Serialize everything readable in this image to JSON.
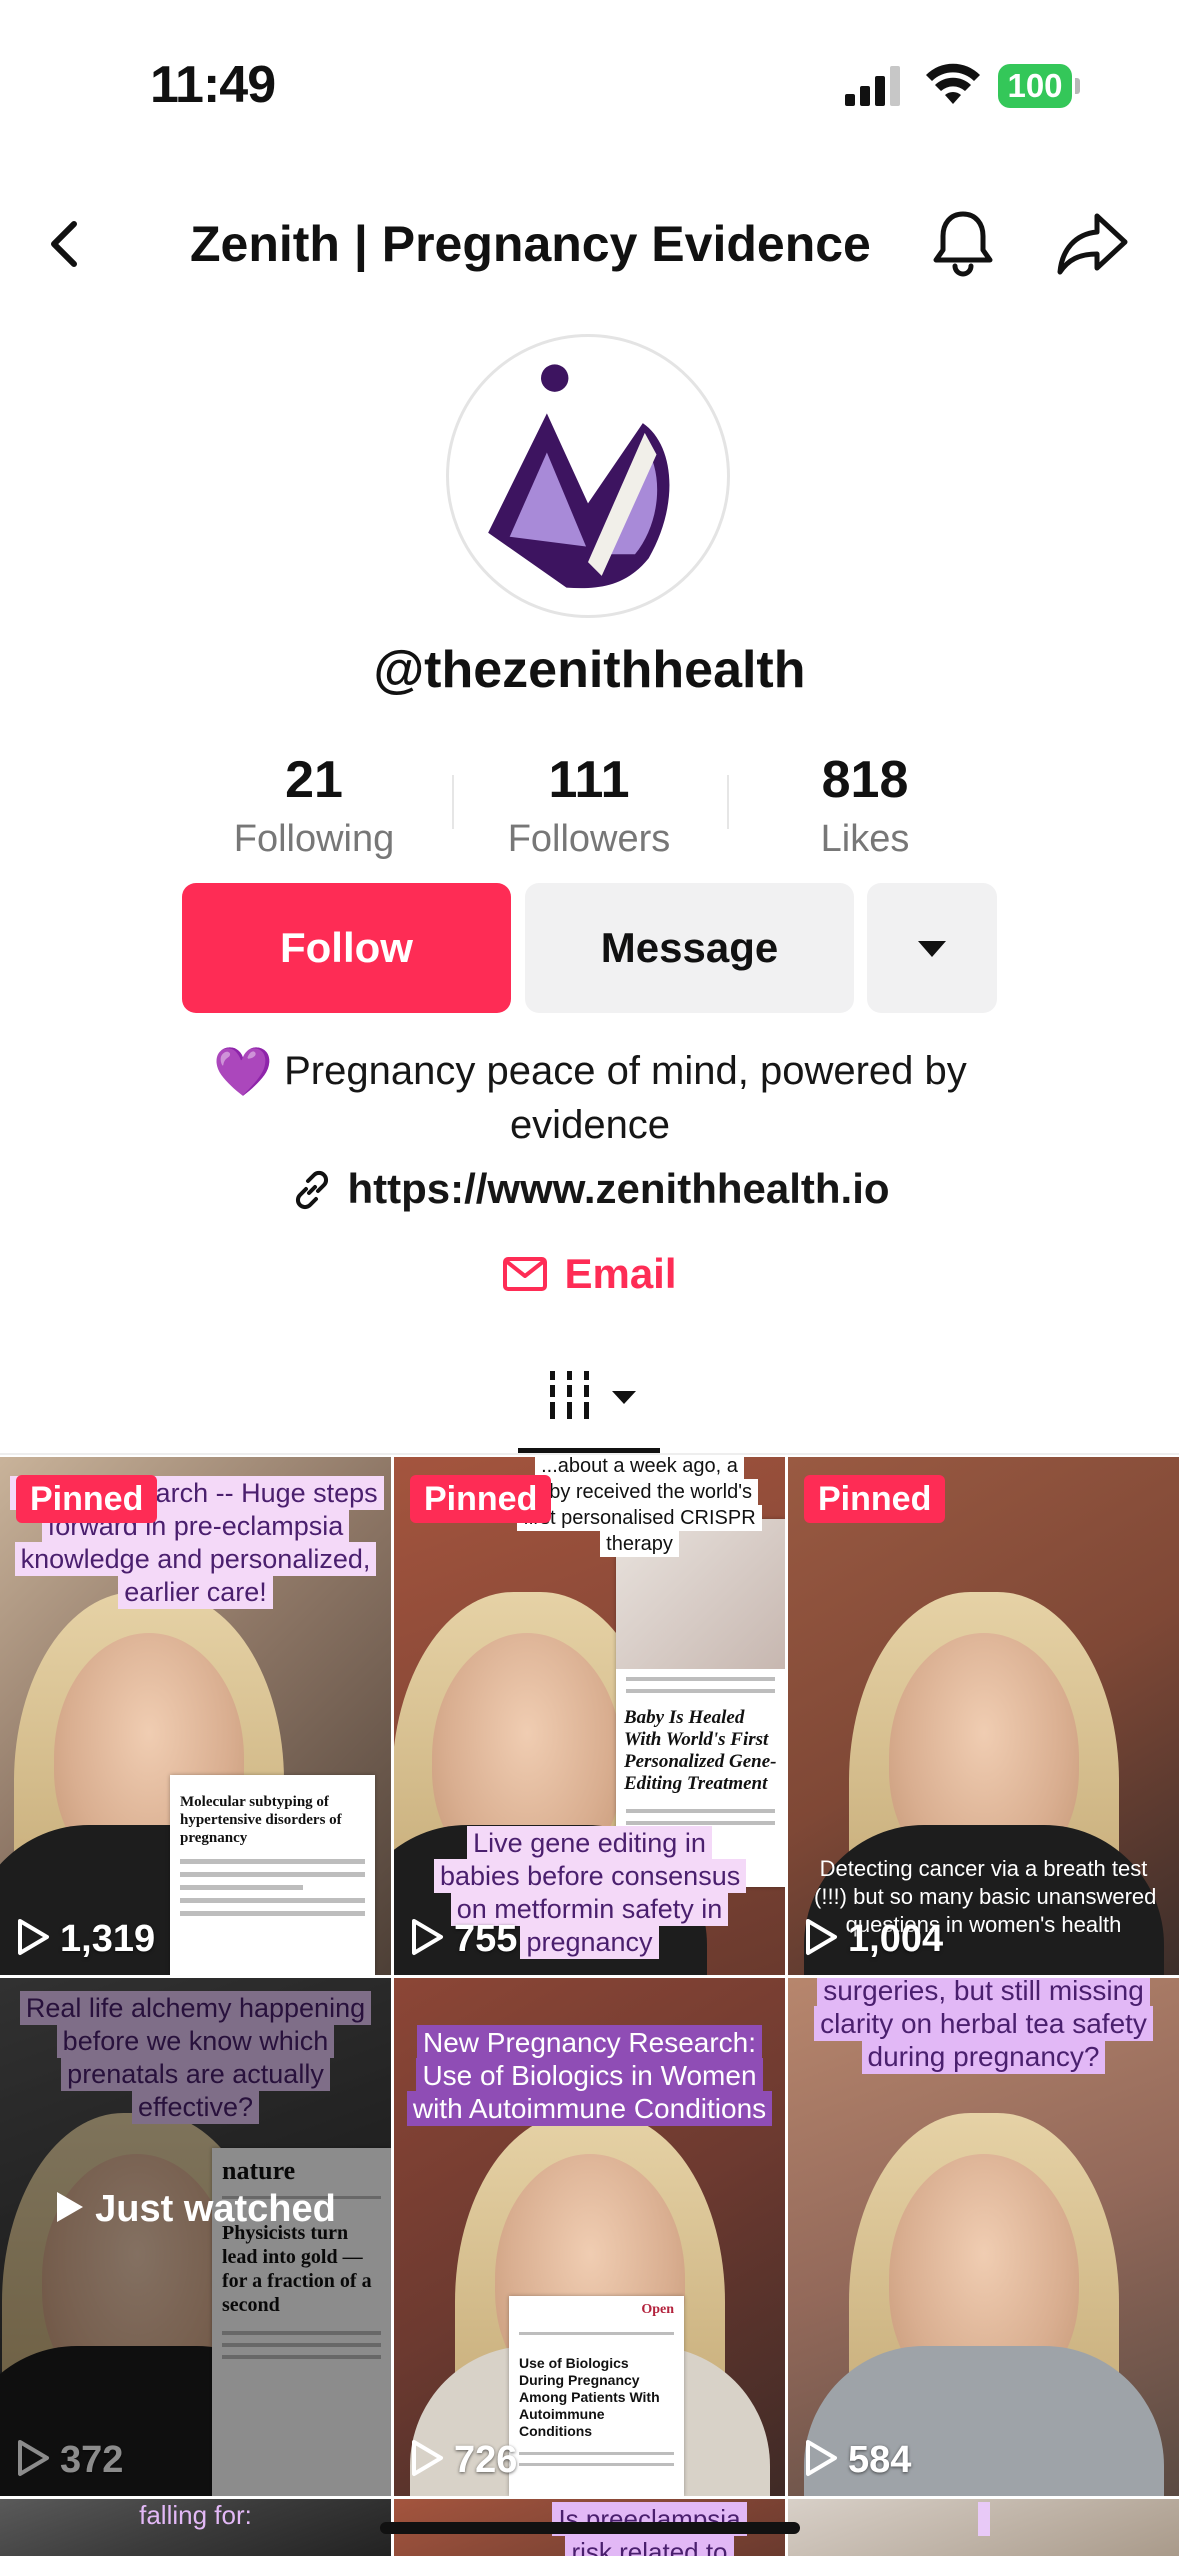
{
  "status_bar": {
    "time": "11:49",
    "battery": "100"
  },
  "header": {
    "title": "Zenith | Pregnancy Evidence"
  },
  "profile": {
    "username": "@thezenithhealth",
    "stats": [
      {
        "value": "21",
        "label": "Following"
      },
      {
        "value": "111",
        "label": "Followers"
      },
      {
        "value": "818",
        "label": "Likes"
      }
    ],
    "buttons": {
      "follow": "Follow",
      "message": "Message"
    },
    "bio": {
      "emoji": "💜",
      "text": "Pregnancy peace of mind, powered by evidence"
    },
    "link": "https://www.zenithhealth.io",
    "email": "Email"
  },
  "videos": [
    {
      "pinned": "Pinned",
      "caption": "...ancy research -- Huge steps forward in pre-eclampsia knowledge and personalized, earlier care!",
      "paper_title": "Molecular subtyping of hypertensive disorders of pregnancy",
      "views": "1,319"
    },
    {
      "pinned": "Pinned",
      "caption_top": "...about a week ago, a baby received the world's first personalised CRISPR therapy",
      "paper_title": "Baby Is Healed With World's First Personalized Gene-Editing Treatment",
      "caption": "Live gene editing in babies before consensus on metformin safety in pregnancy",
      "views": "755"
    },
    {
      "pinned": "Pinned",
      "caption": "Detecting cancer via a breath test (!!!) but so many basic unanswered questions in women's health",
      "views": "1,004"
    },
    {
      "caption": "Real life alchemy happening before we know which prenatals are actually effective?",
      "paper_brand": "nature",
      "paper_title": "Physicists turn lead into gold — for a fraction of a second",
      "views": "372",
      "just_watched": "Just watched"
    },
    {
      "caption": "New Pregnancy Research: Use of Biologics in Women with Autoimmune Conditions",
      "paper_brand": "Open",
      "paper_title": "Use of Biologics During Pregnancy Among Patients With Autoimmune Conditions",
      "views": "726"
    },
    {
      "caption": "surgeries, but still missing clarity on herbal tea safety during pregnancy?",
      "views": "584"
    },
    {
      "caption": "falling for:"
    },
    {
      "caption": "Is preeclampsia risk related to"
    },
    {
      "caption": ""
    }
  ]
}
